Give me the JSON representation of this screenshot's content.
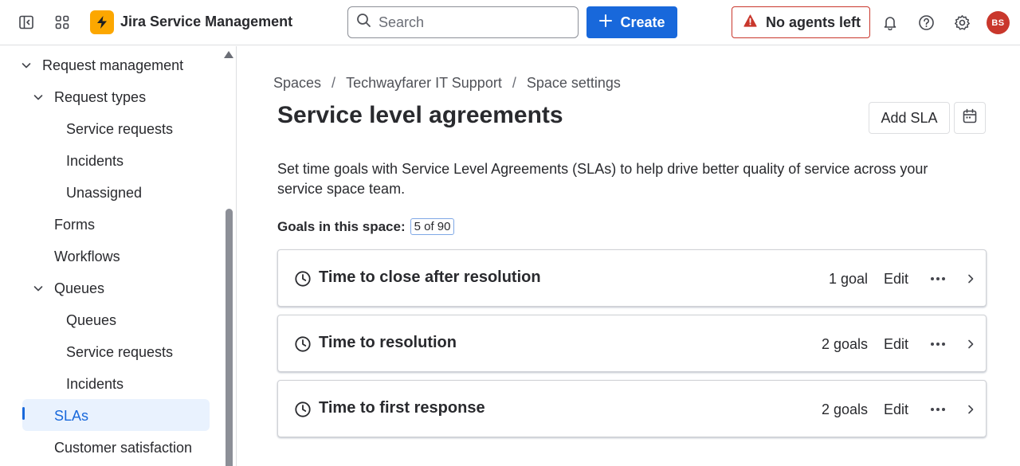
{
  "topbar": {
    "app_name": "Jira Service Management",
    "search_placeholder": "Search",
    "create_label": "Create",
    "agents_warning": "No agents left",
    "avatar_initials": "BS",
    "icons": [
      "sidebar-toggle-icon",
      "app-switcher-icon",
      "lightning-icon",
      "search-icon",
      "plus-icon",
      "warning-icon",
      "bell-icon",
      "help-icon",
      "gear-icon"
    ]
  },
  "sidebar": {
    "items": [
      {
        "label": "Request management",
        "expanded": true
      },
      {
        "label": "Request types",
        "expanded": true
      },
      {
        "label": "Service requests"
      },
      {
        "label": "Incidents"
      },
      {
        "label": "Unassigned"
      },
      {
        "label": "Forms"
      },
      {
        "label": "Workflows"
      },
      {
        "label": "Queues",
        "expanded": true
      },
      {
        "label": "Queues"
      },
      {
        "label": "Service requests"
      },
      {
        "label": "Incidents"
      },
      {
        "label": "SLAs",
        "active": true
      },
      {
        "label": "Customer satisfaction"
      }
    ]
  },
  "breadcrumb": [
    "Spaces",
    "Techwayfarer IT Support",
    "Space settings"
  ],
  "breadcrumb_separator": "/",
  "page": {
    "title": "Service level agreements",
    "add_sla_label": "Add SLA",
    "description": "Set time goals with Service Level Agreements (SLAs) to help drive better quality of service across your service space team.",
    "goals_label": "Goals in this space:",
    "goals_count": "5 of 90"
  },
  "slas": [
    {
      "name": "Time to close after resolution",
      "goals": "1 goal",
      "edit": "Edit"
    },
    {
      "name": "Time to resolution",
      "goals": "2 goals",
      "edit": "Edit"
    },
    {
      "name": "Time to first response",
      "goals": "2 goals",
      "edit": "Edit"
    }
  ],
  "colors": {
    "brand_yellow": "#fca700",
    "primary_blue": "#1868db",
    "danger_red": "#c9372c",
    "active_bg": "#e9f2fe",
    "text": "#292a2e"
  }
}
